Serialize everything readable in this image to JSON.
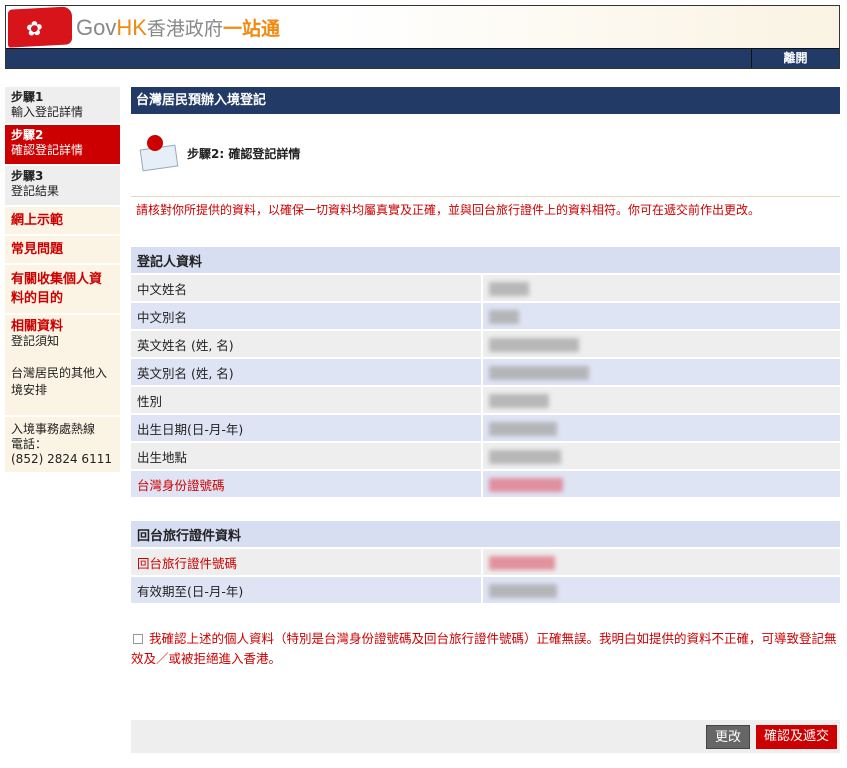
{
  "header": {
    "logo_gov": "Gov",
    "logo_hk": "HK",
    "logo_cn": "香港政府",
    "logo_cn2": "一站通",
    "exit": "離開"
  },
  "sidebar": {
    "step1_title": "步驟1",
    "step1_sub": "輸入登記詳情",
    "step2_title": "步驟2",
    "step2_sub": "確認登記詳情",
    "step3_title": "步驟3",
    "step3_sub": "登記結果",
    "demo": "網上示範",
    "faq": "常見問題",
    "purpose": "有關收集個人資料的目的",
    "related": "相關資料",
    "notes": "登記須知",
    "other": "台灣居民的其他入境安排",
    "hotline": "入境事務處熱線",
    "phone_label": "電話：",
    "phone": "(852) 2824 6111"
  },
  "main": {
    "title": "台灣居民預辦入境登記",
    "step_title": "步驟2: 確認登記詳情",
    "instruction": "請核對你所提供的資料，以確保一切資料均屬真實及正確，並與回台旅行證件上的資料相符。你可在遞交前作出更改。",
    "section1": "登記人資料",
    "fields1": [
      "中文姓名",
      "中文別名",
      "英文姓名 (姓, 名)",
      "英文別名 (姓, 名)",
      "性別",
      "出生日期(日-月-年)",
      "出生地點",
      "台灣身份證號碼"
    ],
    "section2": "回台旅行證件資料",
    "fields2": [
      "回台旅行證件號碼",
      "有效期至(日-月-年)"
    ],
    "confirm_text": "我確認上述的個人資料（特別是台灣身份證號碼及回台旅行證件號碼）正確無誤。我明白如提供的資料不正確，可導致登記無效及／或被拒絕進入香港。",
    "amend": "更改",
    "submit": "確認及遞交"
  }
}
